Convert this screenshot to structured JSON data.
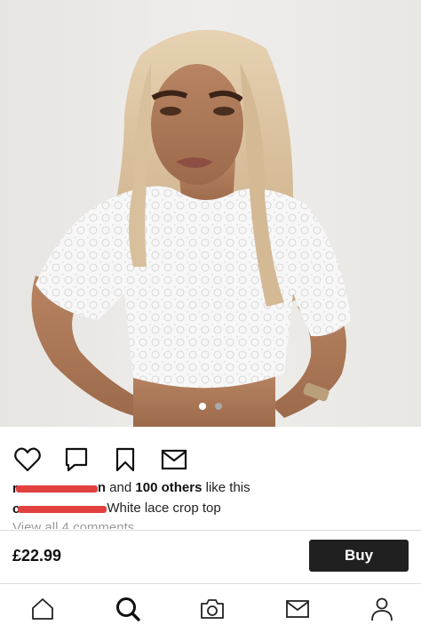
{
  "post": {
    "image": {
      "alt_icon": "product-photo",
      "carousel_count": 2,
      "carousel_active_index": 0
    },
    "actions": {
      "like_icon": "heart-icon",
      "comment_icon": "comment-icon",
      "save_icon": "bookmark-icon",
      "share_icon": "envelope-icon"
    },
    "likes": {
      "user_suffix": "n",
      "connector": " and ",
      "count_label": "100 others",
      "trailing": " like this"
    },
    "caption": {
      "text": "White lace crop top"
    },
    "comments_link": "View all 4 comments"
  },
  "product": {
    "price": "£22.99",
    "buy_label": "Buy",
    "buy_color": "#202020"
  },
  "bottom_nav": {
    "items": [
      "home-icon",
      "search-icon",
      "camera-icon",
      "inbox-icon",
      "profile-icon"
    ],
    "active": "search-icon"
  },
  "colors": {
    "redaction": "#e2403f",
    "muted_text": "#9a9a9a"
  }
}
